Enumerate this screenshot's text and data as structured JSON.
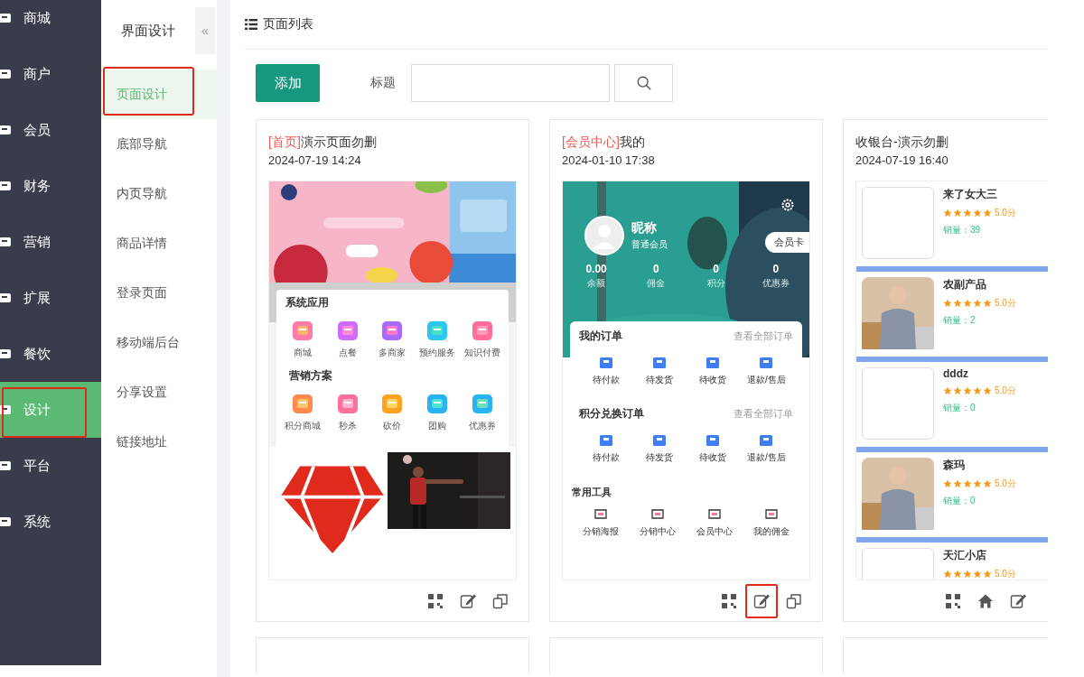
{
  "sidebar": {
    "items": [
      {
        "label": "商城",
        "selected": false,
        "highlighted": false
      },
      {
        "label": "商户",
        "selected": false,
        "highlighted": false
      },
      {
        "label": "会员",
        "selected": false,
        "highlighted": false
      },
      {
        "label": "财务",
        "selected": false,
        "highlighted": false
      },
      {
        "label": "营销",
        "selected": false,
        "highlighted": false
      },
      {
        "label": "扩展",
        "selected": false,
        "highlighted": false
      },
      {
        "label": "餐饮",
        "selected": false,
        "highlighted": false
      },
      {
        "label": "设计",
        "selected": true,
        "highlighted": true
      },
      {
        "label": "平台",
        "selected": false,
        "highlighted": false
      },
      {
        "label": "系统",
        "selected": false,
        "highlighted": false
      }
    ]
  },
  "subnav": {
    "title": "界面设计",
    "collapse_icon": "«",
    "items": [
      {
        "label": "页面设计",
        "selected": true,
        "highlighted": true
      },
      {
        "label": "底部导航",
        "selected": false,
        "highlighted": false
      },
      {
        "label": "内页导航",
        "selected": false,
        "highlighted": false
      },
      {
        "label": "商品详情",
        "selected": false,
        "highlighted": false
      },
      {
        "label": "登录页面",
        "selected": false,
        "highlighted": false
      },
      {
        "label": "移动端后台",
        "selected": false,
        "highlighted": false
      },
      {
        "label": "分享设置",
        "selected": false,
        "highlighted": false
      },
      {
        "label": "链接地址",
        "selected": false,
        "highlighted": false
      }
    ]
  },
  "page": {
    "title": "页面列表"
  },
  "toolbar": {
    "add_button": "添加",
    "title_label": "标题"
  },
  "cards": [
    {
      "kind": "home",
      "tag": "[首页]",
      "name": "演示页面勿删",
      "date": "2024-07-19 14:24",
      "sections": [
        {
          "title": "系统应用",
          "items": [
            "商城",
            "点餐",
            "多商家",
            "预约服务",
            "知识付费"
          ]
        },
        {
          "title": "营销方案",
          "items": [
            "积分商城",
            "秒杀",
            "砍价",
            "团购",
            "优惠券"
          ]
        }
      ],
      "actions": [
        {
          "kind": "qr",
          "highlighted": false
        },
        {
          "kind": "edit",
          "highlighted": false
        },
        {
          "kind": "copy",
          "highlighted": false
        }
      ]
    },
    {
      "kind": "member",
      "tag": "[会员中心]",
      "name": "我的",
      "date": "2024-01-10 17:38",
      "profile": {
        "nickname": "昵称",
        "level": "普通会员",
        "card_button": "会员卡",
        "stats": [
          {
            "value": "0.00",
            "label": "余额"
          },
          {
            "value": "0",
            "label": "佣金"
          },
          {
            "value": "0",
            "label": "积分"
          },
          {
            "value": "0",
            "label": "优惠券"
          }
        ]
      },
      "order_panels": [
        {
          "title": "我的订单",
          "link": "查看全部订单",
          "items": [
            "待付款",
            "待发货",
            "待收货",
            "退款/售后"
          ]
        },
        {
          "title": "积分兑换订单",
          "link": "查看全部订单",
          "items": [
            "待付款",
            "待发货",
            "待收货",
            "退款/售后"
          ]
        }
      ],
      "tools": {
        "title": "常用工具",
        "items": [
          "分销海报",
          "分销中心",
          "会员中心",
          "我的佣金"
        ]
      },
      "actions": [
        {
          "kind": "qr",
          "highlighted": false
        },
        {
          "kind": "edit",
          "highlighted": true
        },
        {
          "kind": "copy",
          "highlighted": false
        }
      ]
    },
    {
      "kind": "products",
      "name": "收银台-演示勿删",
      "date": "2024-07-19 16:40",
      "products": [
        {
          "name": "来了女大三",
          "photo": false,
          "stars": 5,
          "rating": "5.0分",
          "sales_label": "销量：",
          "sales": "39"
        },
        {
          "name": "农副产品",
          "photo": true,
          "stars": 5,
          "rating": "5.0分",
          "sales_label": "销量：",
          "sales": "2"
        },
        {
          "name": "dddz",
          "photo": false,
          "stars": 5,
          "rating": "5.0分",
          "sales_label": "销量：",
          "sales": "0"
        },
        {
          "name": "森玛",
          "photo": true,
          "stars": 5,
          "rating": "5.0分",
          "sales_label": "销量：",
          "sales": "0"
        },
        {
          "name": "天汇小店",
          "photo": false,
          "stars": 5,
          "rating": "5.0分"
        }
      ],
      "actions": [
        {
          "kind": "qr",
          "highlighted": false
        },
        {
          "kind": "home",
          "highlighted": false
        },
        {
          "kind": "edit",
          "highlighted": false
        }
      ]
    }
  ]
}
